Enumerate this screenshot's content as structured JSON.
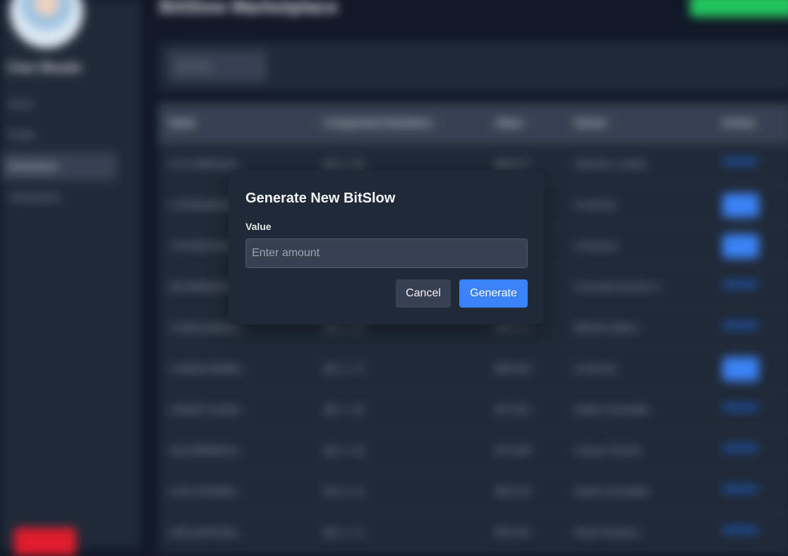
{
  "background": {
    "user_name": "Cian Meade",
    "header_title": "BitSlow Marketplace",
    "nav": [
      "Home",
      "Profile",
      "Marketplace",
      "Transactions"
    ],
    "filter_select": "All Coins",
    "table_headers": [
      "Hash",
      "Component Numbers",
      "Value",
      "Owner",
      "Action"
    ],
    "rows": [
      {
        "hash": "a7c1c9f8e6a4b...",
        "components": "[84, 2, 8]",
        "value": "$38,577",
        "owner": "Vehicles Lozada",
        "action": "link"
      },
      {
        "hash": "c47b59a62fb3e...",
        "components": "[81, 3, 5]",
        "value": "$19,542",
        "owner": "Unowned",
        "action": "button"
      },
      {
        "hash": "7c0c9d51e3c0b...",
        "components": "[21, 8, 9]",
        "value": "$26,419",
        "owner": "Unowned",
        "action": "button"
      },
      {
        "hash": "8b23f9b6ab7a4...",
        "components": "[69, 5, 2]",
        "value": "$21,066",
        "owner": "Concetta Deckow V",
        "action": "link"
      },
      {
        "hash": "1c2b9ce4a8bd3...",
        "components": "[99, 1, 3]",
        "value": "$46,171",
        "owner": "Mitchel Adams",
        "action": "link"
      },
      {
        "hash": "1c0d9e4c8a8bb...",
        "components": "[84, 2, 7]",
        "value": "$38,520",
        "owner": "Unowned",
        "action": "button"
      },
      {
        "hash": "c5b3a07c1ba5e...",
        "components": "[84, 1, 8]",
        "value": "$73,301",
        "owner": "Kaden Schmidler",
        "action": "link"
      },
      {
        "hash": "c9a7d3f4b64c9...",
        "components": "[94, 2, 8]",
        "value": "$74,309",
        "owner": "Carson Kessler",
        "action": "link"
      },
      {
        "hash": "e19cc7f5c9b6c...",
        "components": "[84, 6, 1]",
        "value": "$53,213",
        "owner": "Kaden Schmidler",
        "action": "link"
      },
      {
        "hash": "a4f12ea87b2bc...",
        "components": "[84, 2, 7]",
        "value": "$29,331",
        "owner": "Kelvin Dickens",
        "action": "link"
      }
    ]
  },
  "modal": {
    "title": "Generate New BitSlow",
    "field_label": "Value",
    "input_placeholder": "Enter amount",
    "input_value": "",
    "cancel_label": "Cancel",
    "generate_label": "Generate"
  },
  "colors": {
    "accent": "#3b82f6",
    "surface": "#1f2937",
    "backdrop": "#111827",
    "success": "#22c55e",
    "danger": "#e11d2e"
  }
}
